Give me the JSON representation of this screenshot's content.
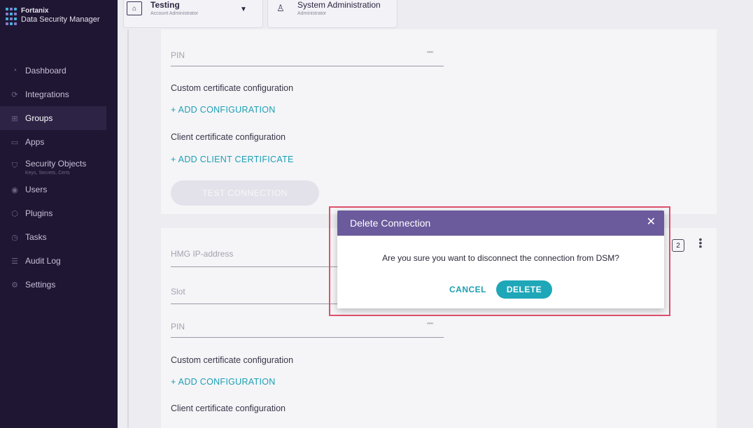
{
  "brand": {
    "line1": "Fortanix",
    "line2": "Data Security Manager"
  },
  "sidebar": {
    "items": [
      {
        "label": "Dashboard",
        "icon": "dashboard-icon"
      },
      {
        "label": "Integrations",
        "icon": "integrations-icon"
      },
      {
        "label": "Groups",
        "icon": "groups-icon",
        "active": true
      },
      {
        "label": "Apps",
        "icon": "apps-icon"
      },
      {
        "label": "Security Objects",
        "sub": "Keys, Secrets, Certs",
        "icon": "security-objects-icon"
      },
      {
        "label": "Users",
        "icon": "users-icon"
      },
      {
        "label": "Plugins",
        "icon": "plugins-icon"
      },
      {
        "label": "Tasks",
        "icon": "tasks-icon"
      },
      {
        "label": "Audit Log",
        "icon": "audit-log-icon"
      },
      {
        "label": "Settings",
        "icon": "settings-icon"
      }
    ]
  },
  "topbar": {
    "account": {
      "name": "Testing",
      "role": "Account Administrator"
    },
    "system": {
      "name": "System Administration",
      "role": "Administrator"
    }
  },
  "card1": {
    "pin_label": "PIN",
    "custom_cert_label": "Custom certificate configuration",
    "add_config": "+ ADD CONFIGURATION",
    "client_cert_label": "Client certificate configuration",
    "add_client_cert": "+ ADD CLIENT CERTIFICATE",
    "test_connection": "TEST CONNECTION"
  },
  "card2": {
    "badge": "2",
    "hmg_label": "HMG IP-address",
    "slot_label": "Slot",
    "pin_label": "PIN",
    "custom_cert_label": "Custom certificate configuration",
    "add_config": "+ ADD CONFIGURATION",
    "client_cert_label": "Client certificate configuration"
  },
  "dialog": {
    "title": "Delete Connection",
    "message": "Are you sure you want to disconnect the connection from DSM?",
    "cancel": "CANCEL",
    "delete": "DELETE"
  },
  "colors": {
    "sidebar_bg": "#1f1633",
    "dialog_header": "#6b5a9c",
    "accent": "#1ea7b8",
    "highlight": "#e0506b"
  }
}
